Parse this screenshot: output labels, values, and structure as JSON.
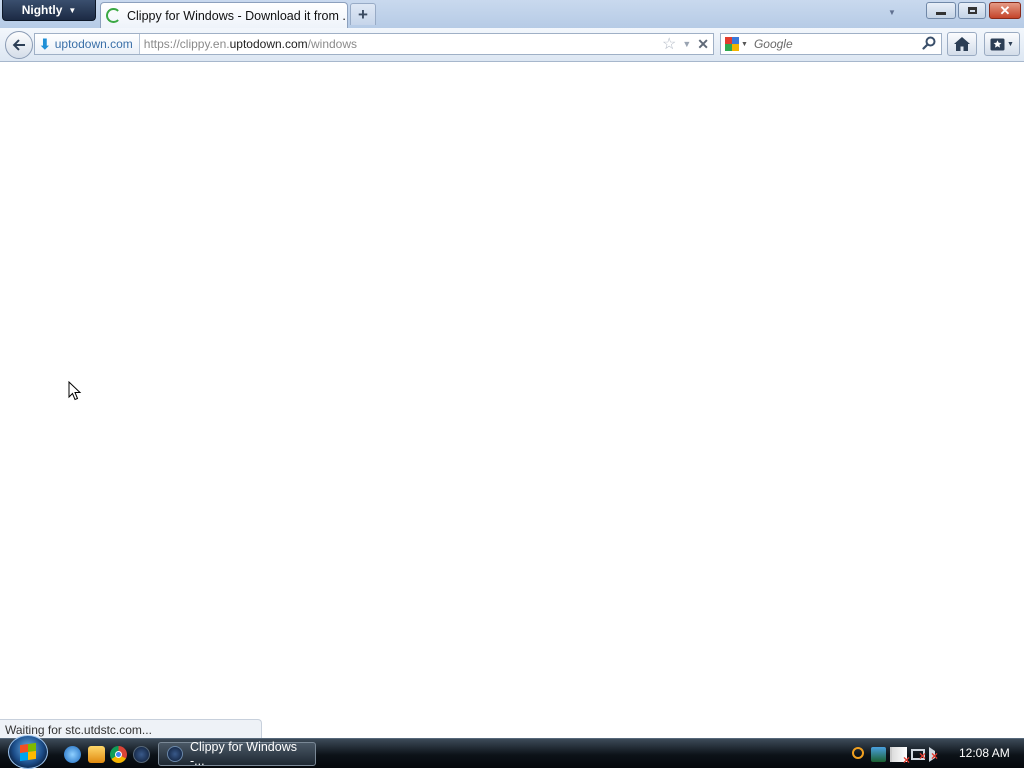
{
  "browser": {
    "app_menu_label": "Nightly",
    "tab": {
      "title": "Clippy for Windows - Download it from ..."
    },
    "new_tab_label": "+"
  },
  "navbar": {
    "identity_label": "uptodown.com",
    "url": {
      "prefix": "https://clippy.en.",
      "host": "uptodown.com",
      "path": "/windows"
    },
    "search": {
      "placeholder": "Google"
    }
  },
  "status": {
    "text": "Waiting for stc.utdstc.com..."
  },
  "taskbar": {
    "task_label": "Clippy for Windows -...",
    "clock": "12:08 AM"
  },
  "colors": {
    "titlebar": "#c9d9ee",
    "nightly_button": "#1c2a44",
    "close_button": "#c4442a",
    "taskbar": "#0c1218",
    "page_background": "#ffffff"
  },
  "icons": [
    "back-arrow-icon",
    "uptodown-logo-icon",
    "bookmark-star-icon",
    "history-dropmarker-icon",
    "stop-icon",
    "google-icon",
    "search-go-icon",
    "home-icon",
    "bookmarks-icon",
    "windows-logo-icon"
  ]
}
